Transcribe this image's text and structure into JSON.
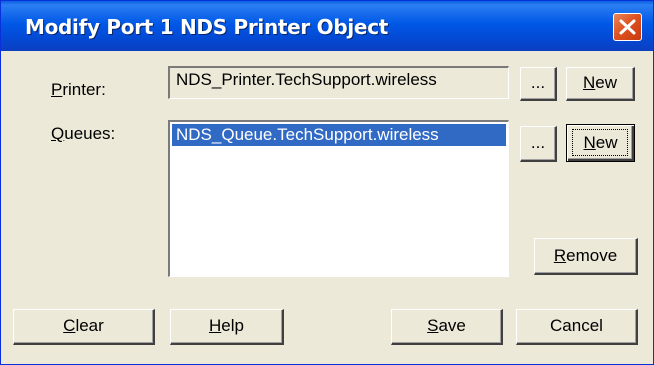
{
  "window": {
    "title": "Modify Port 1 NDS Printer Object"
  },
  "printer": {
    "label": "Printer:",
    "mnemonic": "P",
    "rest": "rinter:",
    "value": "NDS_Printer.TechSupport.wireless",
    "browse_label": "...",
    "new_mnemonic": "N",
    "new_rest": "ew"
  },
  "queues": {
    "label": "Queues:",
    "mnemonic": "Q",
    "rest": "ueues:",
    "items": [
      "NDS_Queue.TechSupport.wireless"
    ],
    "browse_label": "...",
    "new_mnemonic": "N",
    "new_rest": "ew",
    "remove_mnemonic": "R",
    "remove_rest": "emove"
  },
  "footer": {
    "clear_mnemonic": "C",
    "clear_rest": "lear",
    "help_mnemonic": "H",
    "help_rest": "elp",
    "save_mnemonic": "S",
    "save_rest": "ave",
    "cancel_label": "Cancel"
  },
  "colors": {
    "titlebar": "#0058e6",
    "dialog_bg": "#ece9d8",
    "selection": "#316ac5",
    "close_button": "#dc4f1e"
  }
}
